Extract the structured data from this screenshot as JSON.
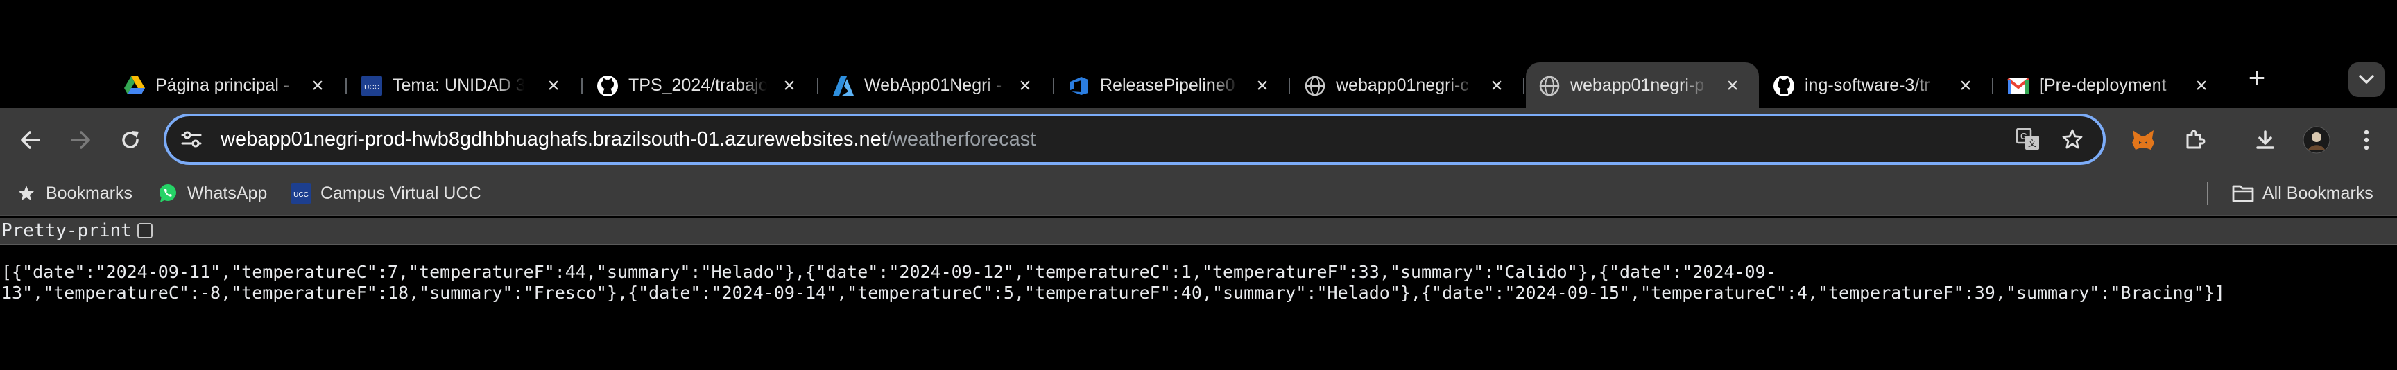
{
  "tabs": [
    {
      "title": "Página principal - ",
      "icon": "google-drive-icon",
      "active": false
    },
    {
      "title": "Tema: UNIDAD 3",
      "icon": "ucc-icon",
      "active": false
    },
    {
      "title": "TPS_2024/trabajo",
      "icon": "github-icon",
      "active": false
    },
    {
      "title": "WebApp01Negri - ",
      "icon": "azure-icon",
      "active": false
    },
    {
      "title": "ReleasePipeline0",
      "icon": "azure-devops-icon",
      "active": false
    },
    {
      "title": "webapp01negri-c",
      "icon": "globe-icon",
      "active": false
    },
    {
      "title": "webapp01negri-p",
      "icon": "globe-icon",
      "active": true
    },
    {
      "title": "ing-software-3/tr",
      "icon": "github-icon",
      "active": false
    },
    {
      "title": "[Pre-deployment ",
      "icon": "gmail-icon",
      "active": false
    }
  ],
  "address_bar": {
    "host": "webapp01negri-prod-hwb8gdhbhuaghafs.brazilsouth-01.azurewebsites.net",
    "path": "/weatherforecast"
  },
  "bookmarks": [
    {
      "label": "Bookmarks",
      "icon": "star-icon"
    },
    {
      "label": "WhatsApp",
      "icon": "whatsapp-icon"
    },
    {
      "label": "Campus Virtual UCC",
      "icon": "ucc-icon"
    }
  ],
  "all_bookmarks_label": "All Bookmarks",
  "page": {
    "pretty_print_label": "Pretty-print",
    "pretty_print_checked": false,
    "json_line1": "[{\"date\":\"2024-09-11\",\"temperatureC\":7,\"temperatureF\":44,\"summary\":\"Helado\"},{\"date\":\"2024-09-12\",\"temperatureC\":1,\"temperatureF\":33,\"summary\":\"Calido\"},{\"date\":\"2024-09-",
    "json_line2": "13\",\"temperatureC\":-8,\"temperatureF\":18,\"summary\":\"Fresco\"},{\"date\":\"2024-09-14\",\"temperatureC\":5,\"temperatureF\":40,\"summary\":\"Helado\"},{\"date\":\"2024-09-15\",\"temperatureC\":4,\"temperatureF\":39,\"summary\":\"Bracing\"}]"
  },
  "colors": {
    "toolbar": "#3b3b3b",
    "omnibox_focus_ring": "#7cacf8",
    "tabstrip": "#000000"
  }
}
